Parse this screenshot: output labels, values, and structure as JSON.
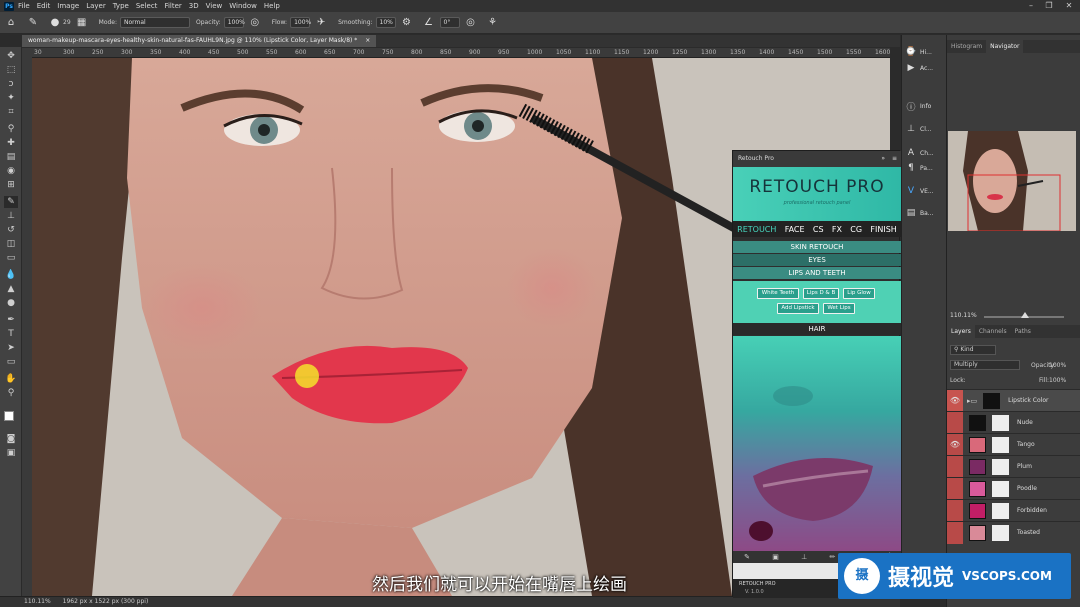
{
  "app": {
    "logo": "Ps"
  },
  "menu": [
    "File",
    "Edit",
    "Image",
    "Layer",
    "Type",
    "Select",
    "Filter",
    "3D",
    "View",
    "Window",
    "Help"
  ],
  "options": {
    "mode_label": "Mode:",
    "mode_value": "Normal",
    "opacity_label": "Opacity:",
    "opacity_value": "100%",
    "flow_label": "Flow:",
    "flow_value": "100%",
    "smoothing_label": "Smoothing:",
    "smoothing_value": "10%",
    "angle_value": "0°",
    "brush_size": "29"
  },
  "document": {
    "tab_title": "woman-makeup-mascara-eyes-healthy-skin-natural-fas-FAUHL9N.jpg @ 110% (Lipstick Color, Layer Mask/8) *",
    "close": "×"
  },
  "ruler_ticks": [
    "30",
    "300",
    "250",
    "300",
    "350",
    "400",
    "450",
    "500",
    "550",
    "600",
    "650",
    "700",
    "750",
    "800",
    "850",
    "900",
    "950",
    "1000",
    "1050",
    "1100",
    "1150",
    "1200",
    "1250",
    "1300",
    "1350",
    "1400",
    "1450",
    "1500",
    "1550",
    "1600"
  ],
  "status": {
    "zoom": "110.11%",
    "size": "1962 px x 1522 px (300 ppi)"
  },
  "strip": [
    {
      "icon": "history-icon",
      "label": "Hi..."
    },
    {
      "icon": "play-icon",
      "label": "Ac..."
    },
    {
      "icon": "info-icon",
      "label": "Info"
    },
    {
      "icon": "clone-source-icon",
      "label": "Cl..."
    },
    {
      "icon": "character-icon",
      "label": "Ch..."
    },
    {
      "icon": "paragraph-icon",
      "label": "Pa..."
    },
    {
      "icon": "v-extension-icon",
      "label": "VE..."
    },
    {
      "icon": "brush-settings-icon",
      "label": "Ba..."
    }
  ],
  "panels": {
    "top_tabs": [
      "Histogram",
      "Navigator"
    ],
    "nav_zoom": "110.11%",
    "layer_tabs": [
      "Layers",
      "Channels",
      "Paths"
    ],
    "kind_label": "Kind",
    "blend_mode": "Multiply",
    "opacity_label": "Opacity:",
    "opacity_value": "100%",
    "lock_label": "Lock:",
    "fill_label": "Fill:",
    "fill_value": "100%",
    "layers": [
      {
        "name": "Lipstick Color",
        "color": "#111111",
        "visible": true,
        "group": true
      },
      {
        "name": "Nude",
        "color": "#111111",
        "visible": false
      },
      {
        "name": "Tango",
        "color": "#d9697a",
        "visible": true
      },
      {
        "name": "Plum",
        "color": "#7a2a63",
        "visible": false
      },
      {
        "name": "Poodle",
        "color": "#d95a9b",
        "visible": false
      },
      {
        "name": "Forbidden",
        "color": "#c21e66",
        "visible": false
      },
      {
        "name": "Toasted",
        "color": "#d98a98",
        "visible": false
      }
    ]
  },
  "retouch": {
    "panel_title": "Retouch Pro",
    "logo": "RETOUCH PRO",
    "tagline": "professional retouch panel",
    "nav": [
      "RETOUCH",
      "FACE",
      "CS",
      "FX",
      "CG",
      "FINISH"
    ],
    "sections": [
      "SKIN RETOUCH",
      "EYES",
      "LIPS AND TEETH",
      "HAIR"
    ],
    "buttons": [
      "White Teeth",
      "Lips D & B",
      "Lip Glow",
      "Add Lipstick",
      "Wet Lips"
    ],
    "version_name": "RETOUCH PRO",
    "version": "V. 1.0.0"
  },
  "subtitle": "然后我们就可以开始在嘴唇上绘画",
  "watermark": {
    "cn": "摄视觉",
    "en": "VSCOPS.COM",
    "logo": "摄"
  }
}
